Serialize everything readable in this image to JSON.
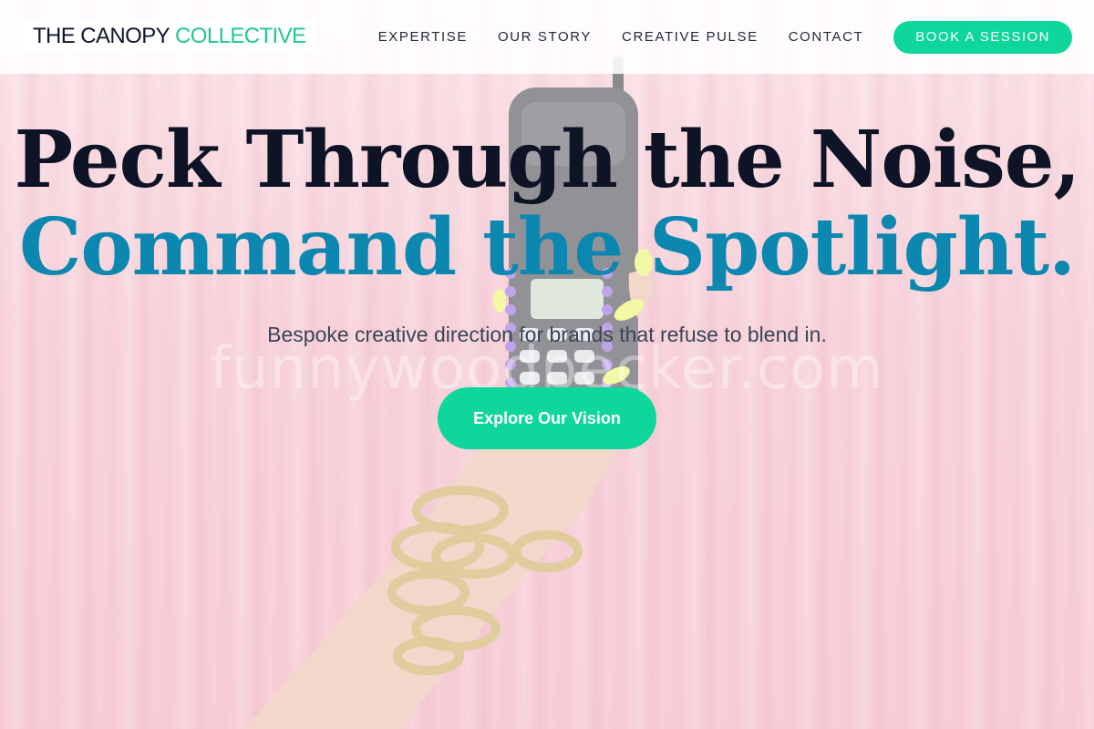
{
  "brand": {
    "name_part1": "THE CANOPY",
    "name_part2": "COLLECTIVE"
  },
  "nav": {
    "items": [
      {
        "label": "EXPERTISE"
      },
      {
        "label": "OUR STORY"
      },
      {
        "label": "CREATIVE PULSE"
      },
      {
        "label": "CONTACT"
      }
    ],
    "cta_label": "BOOK A SESSION"
  },
  "hero": {
    "headline_line1": "Peck Through the Noise,",
    "headline_line2": "Command the Spotlight.",
    "subheading": "Bespoke creative direction for brands that refuse to blend in.",
    "button_label": "Explore Our Vision",
    "watermark": "funnywoodpecker.com",
    "background_image": "hand-holding-jeweled-phone-photo"
  },
  "colors": {
    "accent_green": "#0fd69a",
    "logo_green": "#1ec98f",
    "headline_dark": "#0e1326",
    "headline_blue": "#0c87b0",
    "background_pink": "#f2b9c6"
  }
}
